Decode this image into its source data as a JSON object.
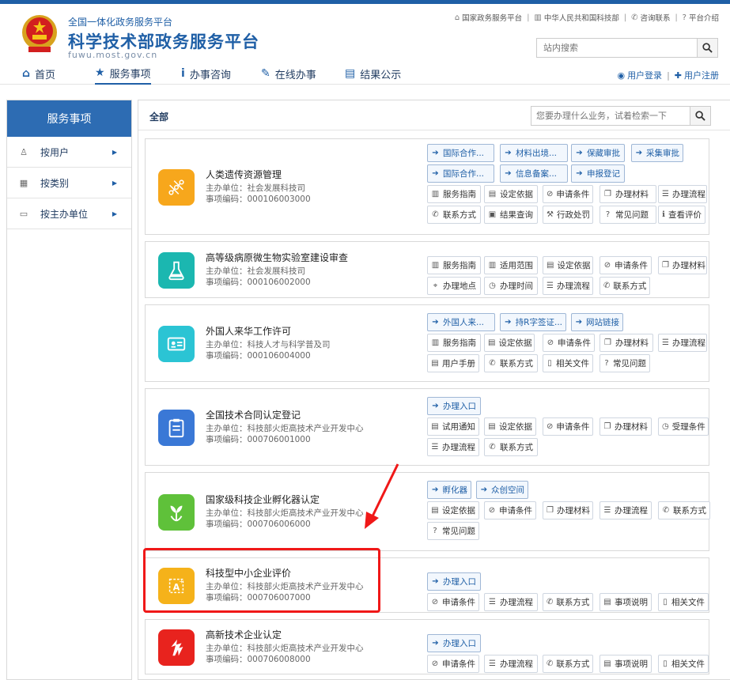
{
  "header": {
    "subtitle": "全国一体化政务服务平台",
    "title": "科学技术部政务服务平台",
    "url": "fuwu.most.gov.cn",
    "top_links": [
      "国家政务服务平台",
      "中华人民共和国科技部",
      "咨询联系",
      "平台介绍"
    ],
    "search_placeholder": "站内搜索"
  },
  "nav": {
    "items": [
      "首页",
      "服务事项",
      "办事咨询",
      "在线办事",
      "结果公示"
    ],
    "active": "服务事项",
    "login": "用户登录",
    "register": "用户注册"
  },
  "sidebar": {
    "title": "服务事项",
    "items": [
      "按用户",
      "按类别",
      "按主办单位"
    ]
  },
  "content": {
    "crumb": "全部",
    "search_placeholder": "您要办理什么业务，试着检索一下"
  },
  "items": [
    {
      "title": "人类遗传资源管理",
      "dept": "主办单位：社会发展科技司",
      "code": "事项编码：000106003000",
      "color": "#f7a71c",
      "tags": [
        [
          "国际合作...",
          "blue"
        ],
        [
          "材料出境...",
          "blue"
        ],
        [
          "保藏审批",
          "blue"
        ],
        [
          "采集审批",
          "blue"
        ],
        [
          "国际合作...",
          "blue"
        ],
        [
          "信息备案...",
          "blue"
        ],
        [
          "申报登记",
          "blue"
        ],
        [
          "服务指南",
          ""
        ],
        [
          "设定依据",
          ""
        ],
        [
          "申请条件",
          ""
        ],
        [
          "办理材料",
          ""
        ],
        [
          "办理流程",
          ""
        ],
        [
          "联系方式",
          ""
        ],
        [
          "结果查询",
          ""
        ],
        [
          "行政处罚",
          ""
        ],
        [
          "常见问题",
          ""
        ],
        [
          "查看评价",
          ""
        ]
      ]
    },
    {
      "title": "高等级病原微生物实验室建设审查",
      "dept": "主办单位：社会发展科技司",
      "code": "事项编码：000106002000",
      "color": "#1bb7b0",
      "tags": [
        [
          "服务指南",
          ""
        ],
        [
          "适用范围",
          ""
        ],
        [
          "设定依据",
          ""
        ],
        [
          "申请条件",
          ""
        ],
        [
          "办理材料",
          ""
        ],
        [
          "办理地点",
          ""
        ],
        [
          "办理时间",
          ""
        ],
        [
          "办理流程",
          ""
        ],
        [
          "联系方式",
          ""
        ]
      ]
    },
    {
      "title": "外国人来华工作许可",
      "dept": "主办单位：科技人才与科学普及司",
      "code": "事项编码：000106004000",
      "color": "#2bc4d4",
      "tags": [
        [
          "外国人来...",
          "blue"
        ],
        [
          "持R字签证...",
          "blue"
        ],
        [
          "网站链接",
          "blue"
        ],
        [
          "服务指南",
          ""
        ],
        [
          "设定依据",
          ""
        ],
        [
          "申请条件",
          ""
        ],
        [
          "办理材料",
          ""
        ],
        [
          "办理流程",
          ""
        ],
        [
          "用户手册",
          ""
        ],
        [
          "联系方式",
          ""
        ],
        [
          "相关文件",
          ""
        ],
        [
          "常见问题",
          ""
        ]
      ]
    },
    {
      "title": "全国技术合同认定登记",
      "dept": "主办单位：科技部火炬高技术产业开发中心",
      "code": "事项编码：000706001000",
      "color": "#3a78d6",
      "tags": [
        [
          "办理入口",
          "blue"
        ],
        [
          "试用通知",
          ""
        ],
        [
          "设定依据",
          ""
        ],
        [
          "申请条件",
          ""
        ],
        [
          "办理材料",
          ""
        ],
        [
          "受理条件",
          ""
        ],
        [
          "办理流程",
          ""
        ],
        [
          "联系方式",
          ""
        ]
      ]
    },
    {
      "title": "国家级科技企业孵化器认定",
      "dept": "主办单位：科技部火炬高技术产业开发中心",
      "code": "事项编码：000706006000",
      "color": "#5fc13a",
      "tags": [
        [
          "孵化器",
          "blue"
        ],
        [
          "众创空间",
          "blue"
        ],
        [
          "设定依据",
          ""
        ],
        [
          "申请条件",
          ""
        ],
        [
          "办理材料",
          ""
        ],
        [
          "办理流程",
          ""
        ],
        [
          "联系方式",
          ""
        ],
        [
          "常见问题",
          ""
        ]
      ]
    },
    {
      "title": "科技型中小企业评价",
      "dept": "主办单位：科技部火炬高技术产业开发中心",
      "code": "事项编码：000706007000",
      "color": "#f5b21a",
      "tags": [
        [
          "办理入口",
          "blue"
        ],
        [
          "申请条件",
          ""
        ],
        [
          "办理流程",
          ""
        ],
        [
          "联系方式",
          ""
        ],
        [
          "事项说明",
          ""
        ],
        [
          "相关文件",
          ""
        ]
      ]
    },
    {
      "title": "高新技术企业认定",
      "dept": "主办单位：科技部火炬高技术产业开发中心",
      "code": "事项编码：000706008000",
      "color": "#e8231e",
      "tags": [
        [
          "办理入口",
          "blue"
        ],
        [
          "申请条件",
          ""
        ],
        [
          "办理流程",
          ""
        ],
        [
          "联系方式",
          ""
        ],
        [
          "事项说明",
          ""
        ],
        [
          "相关文件",
          ""
        ]
      ]
    }
  ],
  "colors": {
    "brand": "#1f5fa6",
    "highlight": "#f01818"
  }
}
